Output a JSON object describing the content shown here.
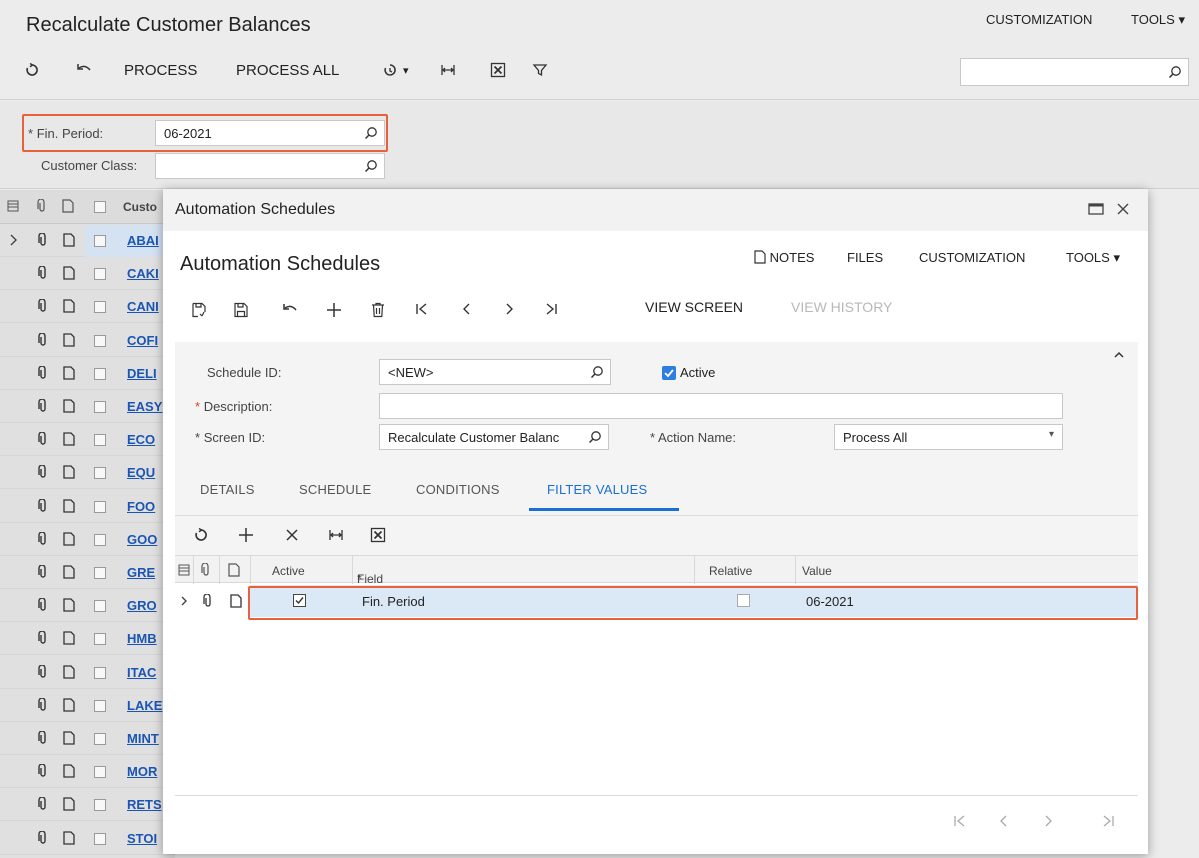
{
  "background": {
    "title": "Recalculate Customer Balances",
    "top_links": {
      "customization": "CUSTOMIZATION",
      "tools": "TOOLS"
    },
    "toolbar": {
      "process": "PROCESS",
      "process_all": "PROCESS ALL"
    },
    "filter": {
      "fin_period_label": "Fin. Period:",
      "fin_period_value": "06-2021",
      "customer_class_label": "Customer Class:",
      "customer_class_value": ""
    },
    "grid": {
      "header_partial": "Custo",
      "rows": [
        "ABAI",
        "CAKI",
        "CANI",
        "COFI",
        "DELI",
        "EASY",
        "ECO",
        "EQU",
        "FOO",
        "GOO",
        "GRE",
        "GRO",
        "HMB",
        "ITAC",
        "LAKE",
        "MINT",
        "MOR",
        "RETS",
        "STOI"
      ]
    }
  },
  "dialog": {
    "window_title": "Automation Schedules",
    "screen_title": "Automation Schedules",
    "top_links": {
      "notes": "NOTES",
      "files": "FILES",
      "customization": "CUSTOMIZATION",
      "tools": "TOOLS"
    },
    "toolbar": {
      "view_screen": "VIEW SCREEN",
      "view_history": "VIEW HISTORY"
    },
    "form": {
      "schedule_id_label": "Schedule ID:",
      "schedule_id_value": "<NEW>",
      "active_label": "Active",
      "description_label": "Description:",
      "description_value": "",
      "screen_id_label": "Screen ID:",
      "screen_id_value": "Recalculate Customer Balanc",
      "action_name_label": "Action Name:",
      "action_name_value": "Process All"
    },
    "tabs": [
      "DETAILS",
      "SCHEDULE",
      "CONDITIONS",
      "FILTER VALUES"
    ],
    "grid": {
      "headers": {
        "active": "Active",
        "field_name": "Field Name",
        "relative": "Relative",
        "value": "Value"
      },
      "rows": [
        {
          "field_name": "Fin. Period",
          "value": "06-2021",
          "active": true,
          "relative": false
        }
      ]
    }
  },
  "colors": {
    "accent": "#1a6fd4",
    "highlight": "#e8603c",
    "selected_row": "#dbe9f7",
    "link": "#1a55b5"
  }
}
